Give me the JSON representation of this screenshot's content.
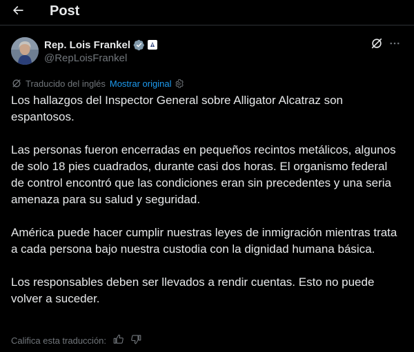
{
  "header": {
    "title": "Post"
  },
  "author": {
    "name": "Rep. Lois Frankel",
    "handle": "@RepLoisFrankel"
  },
  "translation": {
    "label": "Traducido del inglés",
    "show_original": "Mostrar original"
  },
  "post": {
    "paragraphs": [
      "Los hallazgos del Inspector General sobre Alligator Alcatraz son espantosos.",
      "Las personas fueron encerradas en pequeños recintos metálicos, algunos de solo 18 pies cuadrados, durante casi dos horas. El organismo federal de control encontró que las condiciones eran sin precedentes y una seria amenaza para su salud y seguridad.",
      "América puede hacer cumplir nuestras leyes de inmigración mientras trata a cada persona bajo nuestra custodia con la dignidad humana básica.",
      "Los responsables deben ser llevados a rendir cuentas. Esto no puede volver a suceder."
    ]
  },
  "rating": {
    "label": "Califica esta traducción:"
  },
  "icons": {
    "back": "arrow-left-icon",
    "verified": "verified-badge-icon",
    "affiliation": "government-affiliation-icon",
    "grok": "grok-icon",
    "more": "more-horizontal-icon",
    "translate": "translate-icon",
    "settings": "gear-icon",
    "thumbs_up": "thumbs-up-icon",
    "thumbs_down": "thumbs-down-icon"
  },
  "colors": {
    "background": "#000000",
    "text_primary": "#e7e9ea",
    "text_secondary": "#71767b",
    "link": "#1d9bf0",
    "divider": "#2f3336",
    "verified": "#829aab"
  }
}
